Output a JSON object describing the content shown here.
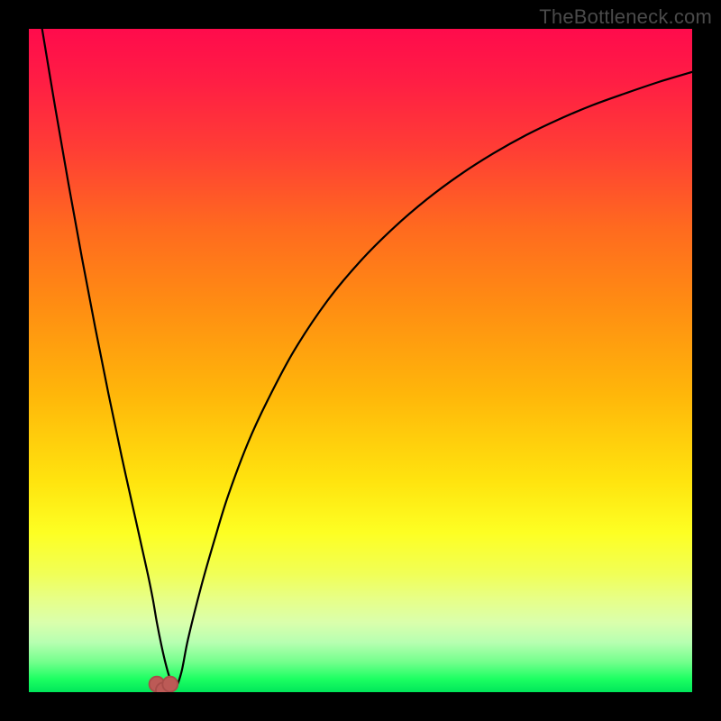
{
  "watermark": "TheBottleneck.com",
  "colors": {
    "frame": "#000000",
    "curve": "#000000",
    "marker_fill": "#bc5a56",
    "marker_stroke": "#a84c49"
  },
  "gradient_stops": [
    {
      "offset": 0.0,
      "color": "#ff0b4c"
    },
    {
      "offset": 0.08,
      "color": "#ff1e44"
    },
    {
      "offset": 0.18,
      "color": "#ff3d35"
    },
    {
      "offset": 0.3,
      "color": "#ff6a1f"
    },
    {
      "offset": 0.42,
      "color": "#ff8e12"
    },
    {
      "offset": 0.55,
      "color": "#ffb60a"
    },
    {
      "offset": 0.68,
      "color": "#ffe30e"
    },
    {
      "offset": 0.76,
      "color": "#fdff23"
    },
    {
      "offset": 0.82,
      "color": "#f1ff55"
    },
    {
      "offset": 0.86,
      "color": "#e7ff88"
    },
    {
      "offset": 0.895,
      "color": "#daffac"
    },
    {
      "offset": 0.925,
      "color": "#b7ffb1"
    },
    {
      "offset": 0.955,
      "color": "#72ff8c"
    },
    {
      "offset": 0.98,
      "color": "#1dff62"
    },
    {
      "offset": 1.0,
      "color": "#00e65a"
    }
  ],
  "chart_data": {
    "type": "line",
    "title": "",
    "xlabel": "",
    "ylabel": "",
    "xlim": [
      0,
      100
    ],
    "ylim": [
      0,
      100
    ],
    "series": [
      {
        "name": "bottleneck-curve",
        "x": [
          2,
          4,
          6,
          8,
          10,
          12,
          14,
          16,
          17,
          18,
          18.7,
          19.3,
          20,
          20.7,
          21.3,
          22,
          23,
          24,
          26,
          28,
          30,
          33,
          36,
          40,
          45,
          50,
          55,
          60,
          65,
          70,
          75,
          80,
          85,
          90,
          95,
          100
        ],
        "y": [
          100,
          88,
          76.5,
          65.5,
          55,
          45,
          35.5,
          26.5,
          22,
          17.5,
          14,
          10.5,
          7,
          4,
          2,
          0.5,
          3,
          8,
          16,
          23,
          29.5,
          37.5,
          44,
          51.5,
          59,
          65,
          70,
          74.3,
          78,
          81.2,
          84,
          86.4,
          88.5,
          90.3,
          92,
          93.5
        ]
      }
    ],
    "markers": [
      {
        "name": "min-left",
        "x": 19.3,
        "y": 1.2
      },
      {
        "name": "min-bottom",
        "x": 20.3,
        "y": 0.3
      },
      {
        "name": "min-right",
        "x": 21.3,
        "y": 1.2
      }
    ],
    "marker_radius_pct": 1.15
  }
}
